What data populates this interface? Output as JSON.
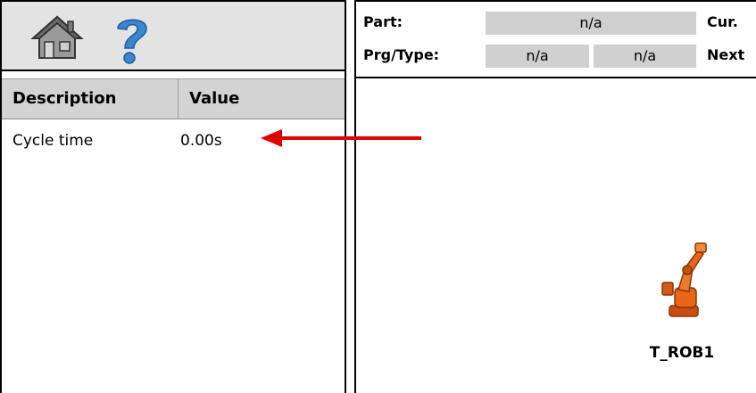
{
  "toolbar": {
    "home_icon": "home-icon",
    "help_icon": "help-icon"
  },
  "table": {
    "headers": [
      "Description",
      "Value"
    ],
    "rows": [
      {
        "description": "Cycle time",
        "value": "0.00s"
      }
    ]
  },
  "info": {
    "part_label": "Part:",
    "part_value": "n/a",
    "cur_label": "Cur.",
    "prg_label": "Prg/Type:",
    "prg_value": "n/a",
    "type_value": "n/a",
    "next_label": "Next"
  },
  "robot": {
    "icon": "robot-arm-icon",
    "label": "T_ROB1"
  },
  "colors": {
    "arrow": "#e00000",
    "robot": "#e8661a",
    "help": "#3a86d0"
  }
}
